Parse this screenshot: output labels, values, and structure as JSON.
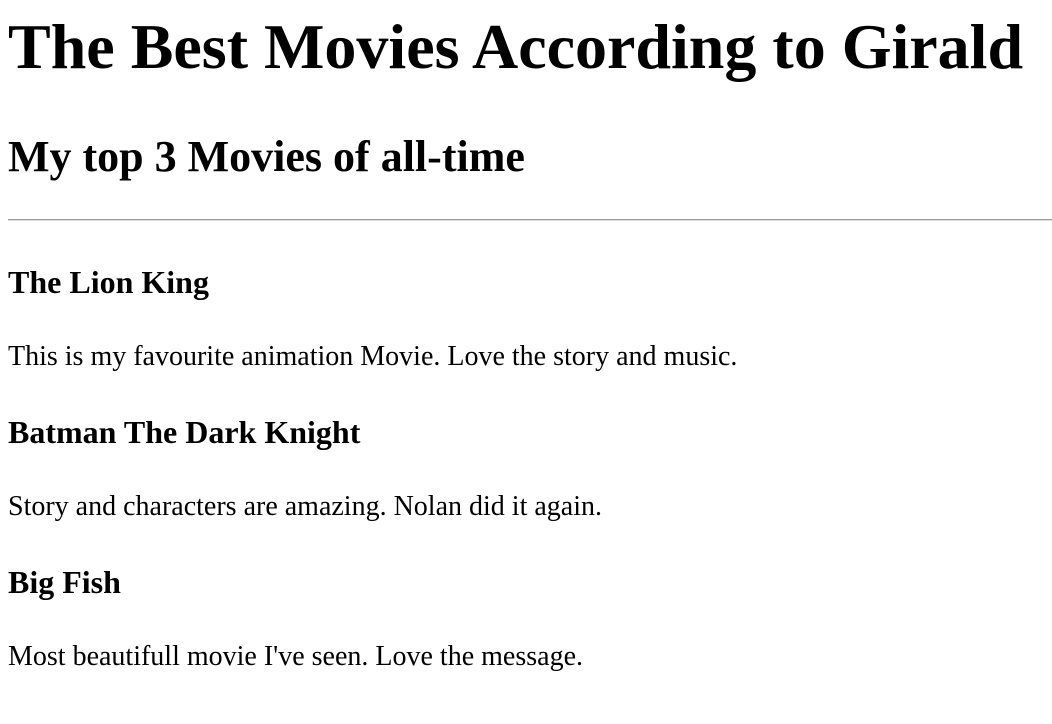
{
  "page": {
    "title": "The Best Movies According to Girald",
    "subtitle": "My top 3 Movies of all-time"
  },
  "movies": [
    {
      "name": "The Lion King",
      "description": "This is my favourite animation Movie. Love the story and music."
    },
    {
      "name": "Batman The Dark Knight",
      "description": "Story and characters are amazing. Nolan did it again."
    },
    {
      "name": "Big Fish",
      "description": "Most beautifull movie I've seen. Love the message."
    }
  ]
}
